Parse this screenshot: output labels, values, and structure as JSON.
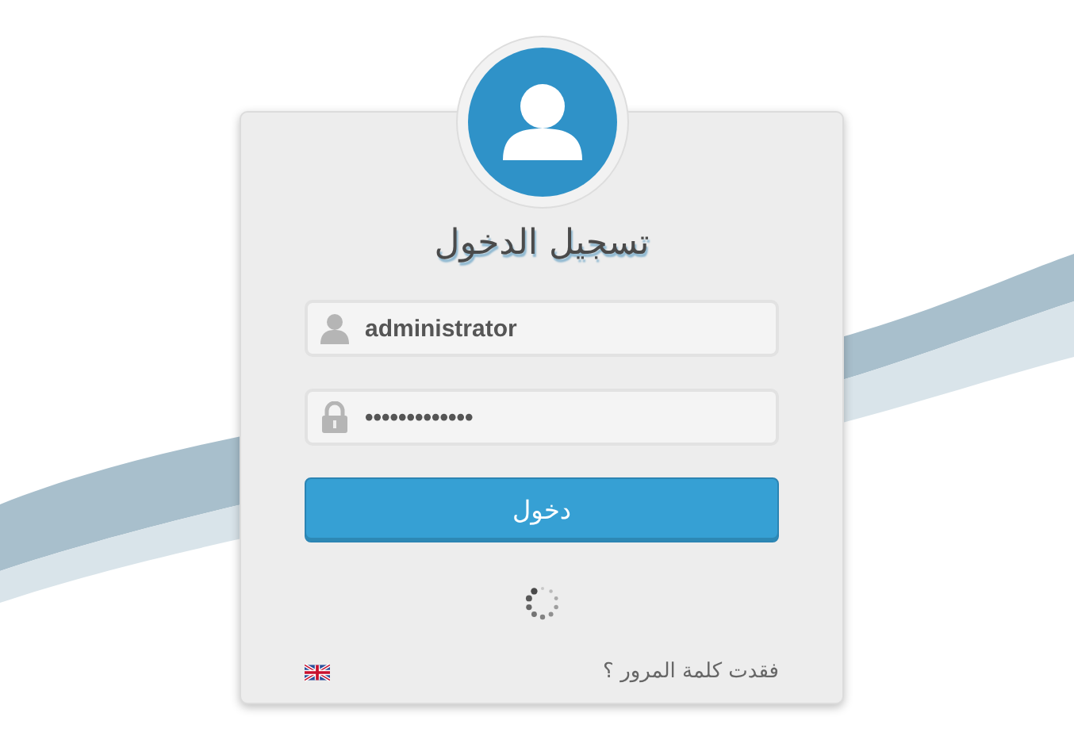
{
  "login": {
    "title": "تسجيل الدخول",
    "username": {
      "value": "administrator"
    },
    "password": {
      "value": "•••••••••••••"
    },
    "submit": "دخول",
    "loading": true,
    "forgot_link": "فقدت كلمة المرور ؟"
  }
}
